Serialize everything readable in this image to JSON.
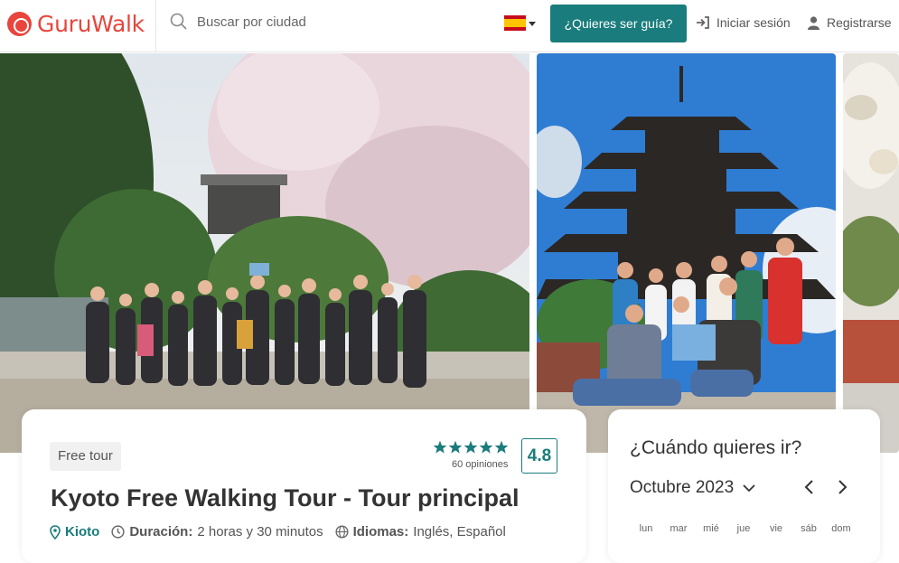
{
  "header": {
    "logo_text": "GuruWalk",
    "search_placeholder": "Buscar por ciudad",
    "guide_button": "¿Quieres ser guía?",
    "login": "Iniciar sesión",
    "register": "Registrarse"
  },
  "tour": {
    "badge": "Free tour",
    "rating": "4.8",
    "reviews": "60 opiniones",
    "stars": 5,
    "title": "Kyoto Free Walking Tour - Tour principal",
    "city": "Kioto",
    "duration_label": "Duración:",
    "duration_value": "2 horas y 30 minutos",
    "languages_label": "Idiomas:",
    "languages_value": "Inglés, Español"
  },
  "calendar": {
    "title": "¿Cuándo quieres ir?",
    "month": "Octubre 2023",
    "weekdays": [
      "lun",
      "mar",
      "mié",
      "jue",
      "vie",
      "sáb",
      "dom"
    ]
  },
  "colors": {
    "brand": "#e8453c",
    "accent": "#1a7c7c"
  }
}
